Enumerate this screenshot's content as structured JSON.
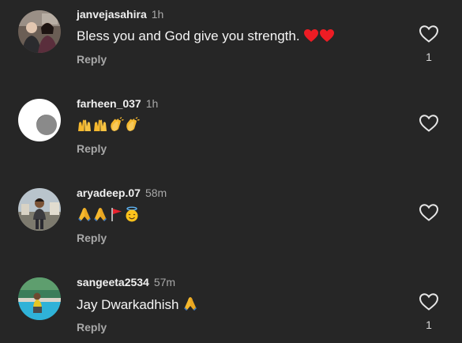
{
  "comments": [
    {
      "username": "janvejasahira",
      "time": "1h",
      "text": "Bless you and God give you strength.",
      "emojis": [
        "red-heart",
        "red-heart"
      ],
      "reply_label": "Reply",
      "like_count": "1"
    },
    {
      "username": "farheen_037",
      "time": "1h",
      "text": "",
      "emojis": [
        "raised-hands",
        "raised-hands",
        "clapping-hands",
        "clapping-hands"
      ],
      "reply_label": "Reply",
      "like_count": ""
    },
    {
      "username": "aryadeep.07",
      "time": "58m",
      "text": "",
      "emojis": [
        "folded-hands",
        "folded-hands",
        "triangular-flag",
        "smiling-face-with-halo"
      ],
      "reply_label": "Reply",
      "like_count": ""
    },
    {
      "username": "sangeeta2534",
      "time": "57m",
      "text": "Jay Dwarkadhish",
      "emojis": [
        "folded-hands"
      ],
      "reply_label": "Reply",
      "like_count": "1"
    }
  ],
  "colors": {
    "background": "#262626",
    "username": "#f0f0f0",
    "secondary_text": "#a8a8a8",
    "heart_emoji": "#ed1c24",
    "like_outline": "#e6e6e6"
  }
}
